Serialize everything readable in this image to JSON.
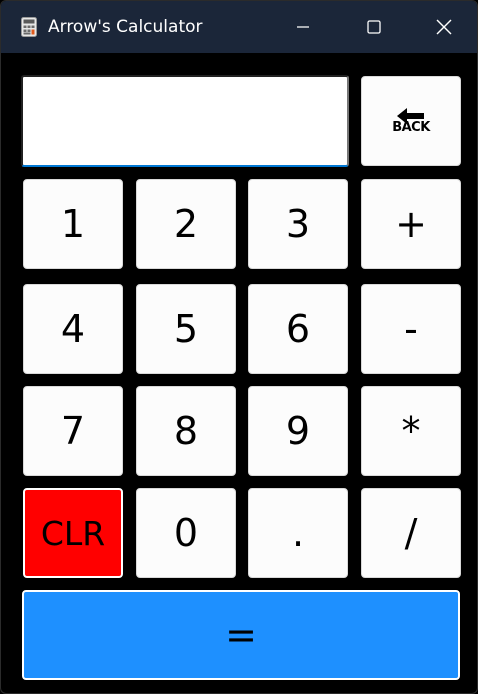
{
  "window": {
    "title": "Arrow's Calculator",
    "controls": [
      "minimize",
      "maximize",
      "close"
    ]
  },
  "display": {
    "value": "",
    "accent": "#0078d4"
  },
  "keys": {
    "back": "BACK",
    "one": "1",
    "two": "2",
    "three": "3",
    "plus": "+",
    "four": "4",
    "five": "5",
    "six": "6",
    "minus": "-",
    "seven": "7",
    "eight": "8",
    "nine": "9",
    "multiply": "*",
    "clear": "CLR",
    "zero": "0",
    "dot": ".",
    "divide": "/",
    "equals": "="
  },
  "colors": {
    "titlebar": "#1b2639",
    "background": "#000000",
    "key": "#fcfcfc",
    "clear": "#ff0000",
    "equals": "#1e90ff"
  },
  "icons": {
    "app": "calculator-icon",
    "back": "left-arrow-icon"
  }
}
